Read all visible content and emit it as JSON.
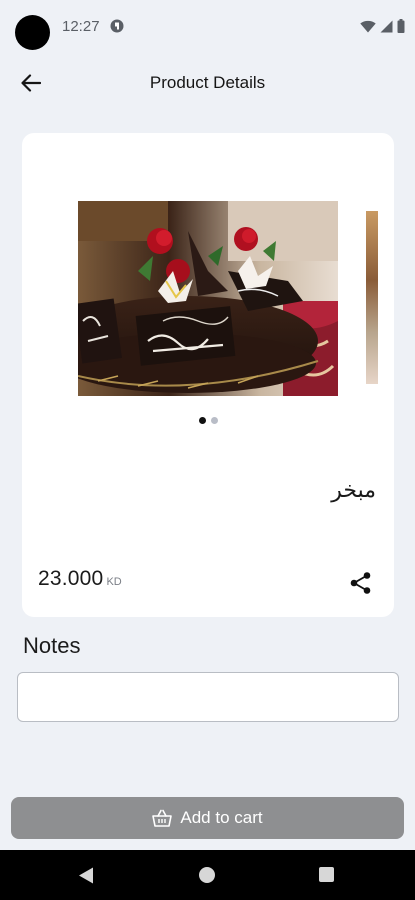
{
  "status_bar": {
    "time": "12:27",
    "icons": [
      "camera-cutout",
      "app-notification-icon",
      "wifi-icon",
      "cellular-signal-icon",
      "battery-icon"
    ]
  },
  "app_bar": {
    "title": "Product Details",
    "back_icon": "arrow-left-icon"
  },
  "product": {
    "image_description_icon": "product-photo",
    "carousel_count": 2,
    "carousel_active_index": 0,
    "name": "مبخر",
    "price": "23.000",
    "currency": "KD",
    "share_icon": "share-icon"
  },
  "notes": {
    "label": "Notes",
    "value": "",
    "placeholder": ""
  },
  "cart": {
    "add_label": "Add to cart",
    "icon": "basket-icon"
  },
  "colors": {
    "background": "#eef1f6",
    "card": "#ffffff",
    "button_disabled": "#8e8f91",
    "dot_active": "#111111",
    "dot_inactive": "#b9bdc7"
  }
}
